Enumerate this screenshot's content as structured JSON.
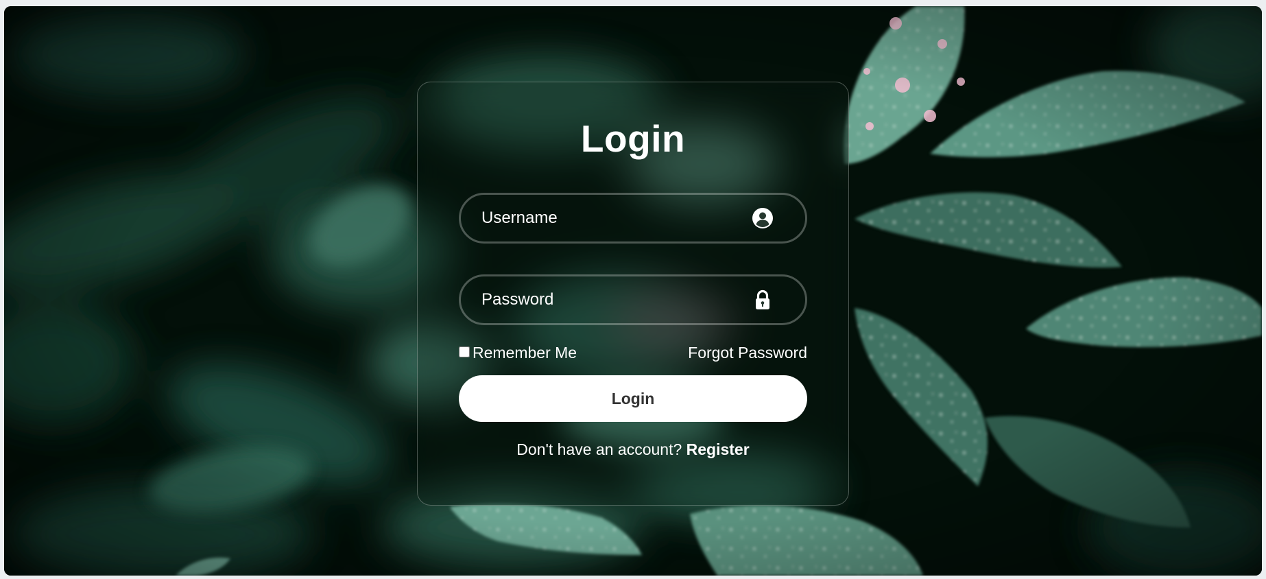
{
  "login_form": {
    "title": "Login",
    "username": {
      "placeholder": "Username",
      "value": ""
    },
    "password": {
      "placeholder": "Password",
      "value": ""
    },
    "remember_label": "Remember Me",
    "remember_checked": false,
    "forgot_label": "Forgot Password",
    "submit_label": "Login",
    "register_prompt": "Don't have an account?",
    "register_label": "Register"
  },
  "icons": {
    "username": "user-circle-icon",
    "password": "lock-icon"
  },
  "colors": {
    "button_bg": "#ffffff",
    "button_text": "#333333",
    "text": "#ffffff",
    "background_leaf": "#5f9c88",
    "background_dark": "#031009",
    "raindrop_highlight": "#f2bdd0"
  }
}
